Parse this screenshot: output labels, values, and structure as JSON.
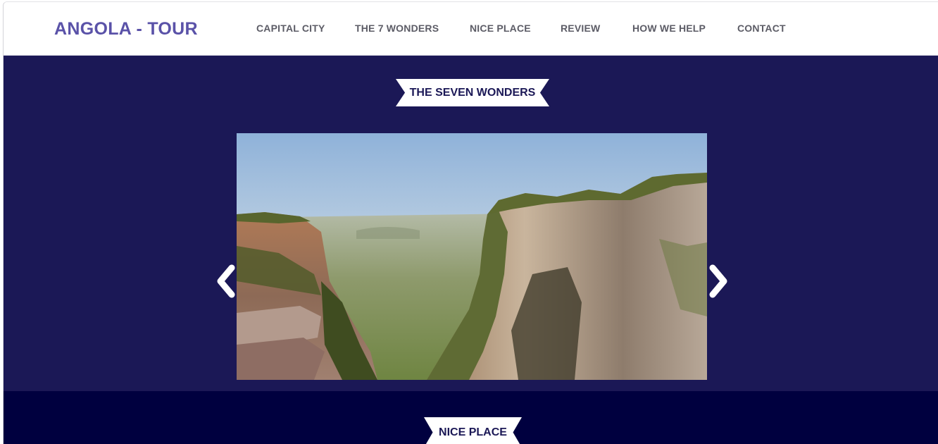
{
  "navbar": {
    "brand": "ANGOLA - TOUR",
    "items": [
      {
        "label": "CAPITAL CITY"
      },
      {
        "label": "THE 7 WONDERS"
      },
      {
        "label": "NICE PLACE"
      },
      {
        "label": "REVIEW"
      },
      {
        "label": "HOW WE HELP"
      },
      {
        "label": "CONTACT"
      }
    ]
  },
  "wonders": {
    "title": "THE SEVEN WONDERS",
    "carousel": {
      "prev_icon": "chevron-left-icon",
      "next_icon": "chevron-right-icon"
    }
  },
  "nice_place": {
    "title": "NICE PLACE"
  },
  "colors": {
    "brand": "#5a52a8",
    "nav_text": "#5c5c66",
    "wonders_bg": "#1b1856",
    "nice_bg": "#00003f",
    "ribbon_bg": "#ffffff"
  }
}
